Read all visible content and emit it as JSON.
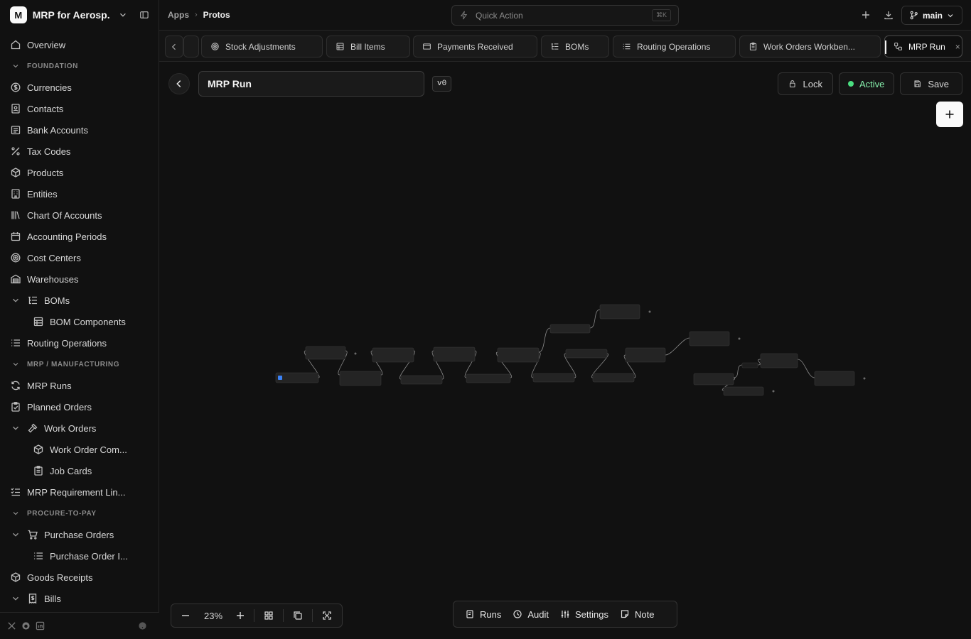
{
  "workspace": {
    "initial": "M",
    "name": "MRP for Aerosp..."
  },
  "sidebar": {
    "items": [
      {
        "kind": "item",
        "label": "Overview",
        "icon": "home-icon",
        "level": 0
      },
      {
        "kind": "section",
        "label": "FOUNDATION"
      },
      {
        "kind": "item",
        "label": "Currencies",
        "icon": "currency-icon",
        "level": 0
      },
      {
        "kind": "item",
        "label": "Contacts",
        "icon": "contacts-icon",
        "level": 0
      },
      {
        "kind": "item",
        "label": "Bank Accounts",
        "icon": "bank-icon",
        "level": 0
      },
      {
        "kind": "item",
        "label": "Tax Codes",
        "icon": "percent-icon",
        "level": 0
      },
      {
        "kind": "item",
        "label": "Products",
        "icon": "package-icon",
        "level": 0
      },
      {
        "kind": "item",
        "label": "Entities",
        "icon": "building-icon",
        "level": 0
      },
      {
        "kind": "item",
        "label": "Chart Of Accounts",
        "icon": "library-icon",
        "level": 0
      },
      {
        "kind": "item",
        "label": "Accounting Periods",
        "icon": "calendar-icon",
        "level": 0
      },
      {
        "kind": "item",
        "label": "Cost Centers",
        "icon": "target-icon",
        "level": 0
      },
      {
        "kind": "item",
        "label": "Warehouses",
        "icon": "warehouse-icon",
        "level": 0
      },
      {
        "kind": "item",
        "label": "BOMs",
        "icon": "list-tree-icon",
        "level": 0,
        "expand": true
      },
      {
        "kind": "item",
        "label": "BOM Components",
        "icon": "table-icon",
        "level": 1
      },
      {
        "kind": "item",
        "label": "Routing Operations",
        "icon": "list-icon",
        "level": 0
      },
      {
        "kind": "section",
        "label": "MRP / MANUFACTURING"
      },
      {
        "kind": "item",
        "label": "MRP Runs",
        "icon": "refresh-icon",
        "level": 0
      },
      {
        "kind": "item",
        "label": "Planned Orders",
        "icon": "clipboard-check-icon",
        "level": 0
      },
      {
        "kind": "item",
        "label": "Work Orders",
        "icon": "hammer-icon",
        "level": 0,
        "expand": true
      },
      {
        "kind": "item",
        "label": "Work Order Com...",
        "icon": "package-icon",
        "level": 1
      },
      {
        "kind": "item",
        "label": "Job Cards",
        "icon": "clipboard-icon",
        "level": 1
      },
      {
        "kind": "item",
        "label": "MRP Requirement Lin...",
        "icon": "list-checks-icon",
        "level": 0
      },
      {
        "kind": "section",
        "label": "PROCURE-TO-PAY"
      },
      {
        "kind": "item",
        "label": "Purchase Orders",
        "icon": "cart-icon",
        "level": 0,
        "expand": true
      },
      {
        "kind": "item",
        "label": "Purchase Order I...",
        "icon": "list-icon",
        "level": 1
      },
      {
        "kind": "item",
        "label": "Goods Receipts",
        "icon": "package-icon",
        "level": 0
      },
      {
        "kind": "item",
        "label": "Bills",
        "icon": "receipt-icon",
        "level": 0,
        "expand": true
      }
    ]
  },
  "topbar": {
    "breadcrumb": [
      "Apps",
      "Protos"
    ],
    "quick_action": "Quick Action",
    "shortcut": "⌘K",
    "branch": "main"
  },
  "tabs": [
    {
      "label": "Stock Adjustments",
      "icon": "target-icon"
    },
    {
      "label": "Bill Items",
      "icon": "table-icon"
    },
    {
      "label": "Payments Received",
      "icon": "card-icon"
    },
    {
      "label": "BOMs",
      "icon": "list-tree-icon"
    },
    {
      "label": "Routing Operations",
      "icon": "list-icon"
    },
    {
      "label": "Work Orders Workben...",
      "icon": "clipboard-icon"
    },
    {
      "label": "MRP Run",
      "icon": "workflow-icon",
      "active": true,
      "close": "×"
    }
  ],
  "editor": {
    "title": "MRP Run",
    "version": "v0",
    "lock_label": "Lock",
    "status_label": "Active",
    "save_label": "Save",
    "status_color": "#4ade80"
  },
  "zoom": {
    "level": "23%"
  },
  "bottom_bar": {
    "runs": "Runs",
    "audit": "Audit",
    "settings": "Settings",
    "note": "Note"
  }
}
